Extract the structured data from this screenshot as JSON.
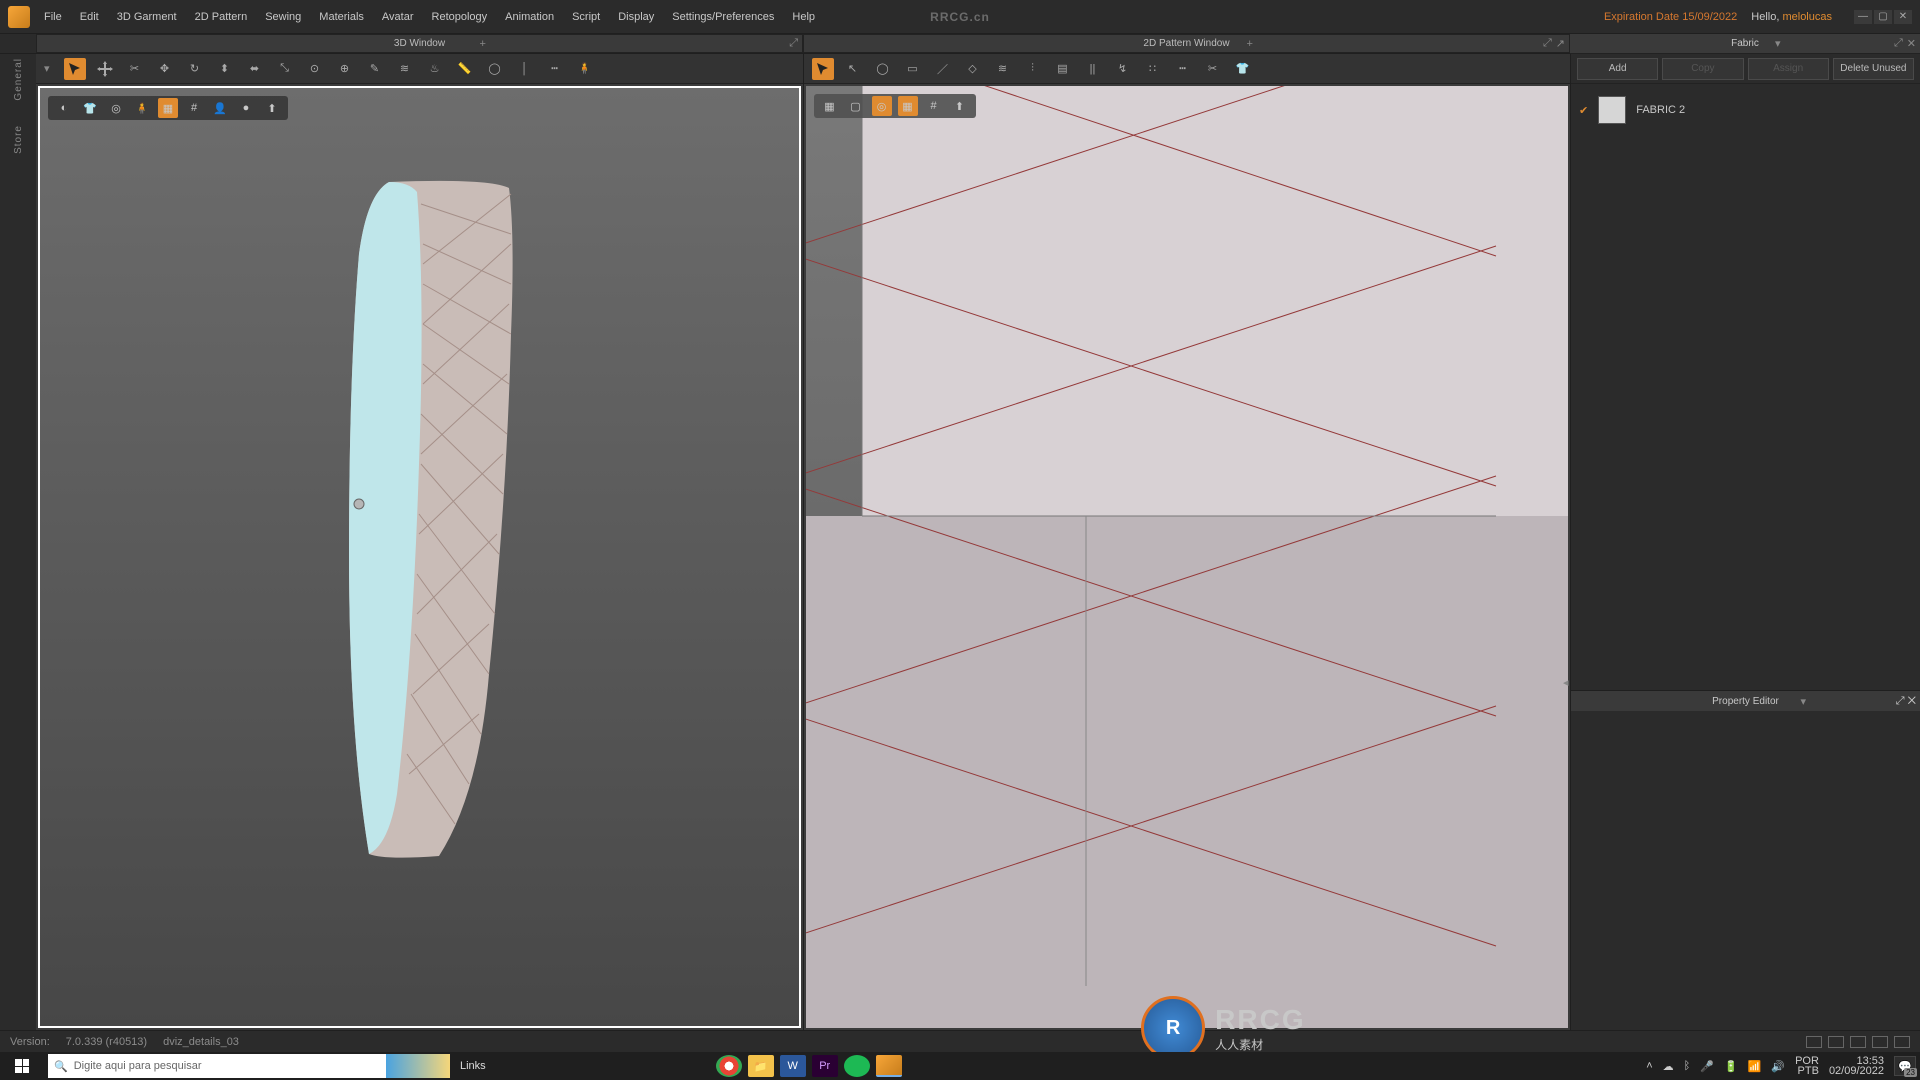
{
  "watermark_top": "RRCG.cn",
  "menu": {
    "file": "File",
    "edit": "Edit",
    "garment3d": "3D Garment",
    "pattern2d": "2D Pattern",
    "sewing": "Sewing",
    "materials": "Materials",
    "avatar": "Avatar",
    "retopology": "Retopology",
    "animation": "Animation",
    "script": "Script",
    "display": "Display",
    "settings": "Settings/Preferences",
    "help": "Help"
  },
  "expiration": "Expiration Date 15/09/2022",
  "hello_prefix": "Hello, ",
  "username": "melolucas",
  "tabs": {
    "w3d": "3D Window",
    "w2d": "2D Pattern Window"
  },
  "sidebar": {
    "general": "General",
    "store": "Store"
  },
  "fabric_panel": {
    "title": "Fabric",
    "add": "Add",
    "copy": "Copy",
    "assign": "Assign",
    "delete": "Delete Unused",
    "items": [
      {
        "name": "FABRIC 2"
      }
    ]
  },
  "property_editor": {
    "title": "Property Editor"
  },
  "status": {
    "version_label": "Version:",
    "version": "7.0.339 (r40513)",
    "filename": "dviz_details_03"
  },
  "taskbar": {
    "search_placeholder": "Digite aqui para pesquisar",
    "links": "Links",
    "locale_lang": "POR",
    "locale_kbd": "PTB",
    "time": "13:53",
    "date": "02/09/2022",
    "notif_count": "23"
  },
  "big_watermark": {
    "logo": "R",
    "l1": "RRCG",
    "l2": "人人素材"
  }
}
